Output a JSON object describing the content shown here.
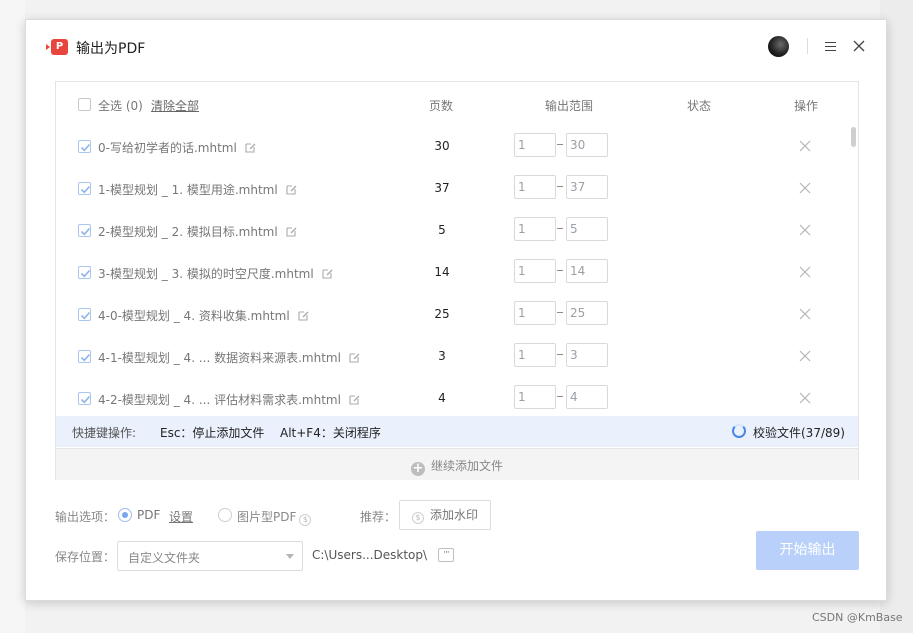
{
  "window": {
    "title": "输出为PDF",
    "logo_glyph": "P"
  },
  "table": {
    "header": {
      "select_all": "全选 (0)",
      "clear_all": "清除全部",
      "col_pages": "页数",
      "col_range": "输出范围",
      "col_status": "状态",
      "col_action": "操作"
    },
    "rows": [
      {
        "name": "0-写给初学者的话.mhtml",
        "pages": "30",
        "from": "1",
        "to": "30",
        "checked": true
      },
      {
        "name": "1-模型规划 _ 1. 模型用途.mhtml",
        "pages": "37",
        "from": "1",
        "to": "37",
        "checked": true
      },
      {
        "name": "2-模型规划 _ 2. 模拟目标.mhtml",
        "pages": "5",
        "from": "1",
        "to": "5",
        "checked": true
      },
      {
        "name": "3-模型规划 _ 3. 模拟的时空尺度.mhtml",
        "pages": "14",
        "from": "1",
        "to": "14",
        "checked": true
      },
      {
        "name": "4-0-模型规划 _ 4. 资料收集.mhtml",
        "pages": "25",
        "from": "1",
        "to": "25",
        "checked": true
      },
      {
        "name": "4-1-模型规划 _ 4. ... 数据资料来源表.mhtml",
        "pages": "3",
        "from": "1",
        "to": "3",
        "checked": true
      },
      {
        "name": "4-2-模型规划 _ 4. ... 评估材料需求表.mhtml",
        "pages": "4",
        "from": "1",
        "to": "4",
        "checked": true
      }
    ]
  },
  "shortcuts": {
    "label": "快捷键操作:",
    "esc": "Esc：停止添加文件",
    "altf4": "Alt+F4：关闭程序",
    "validate": "校验文件(37/89)"
  },
  "add_more": "继续添加文件",
  "options": {
    "label": "输出选项：",
    "pdf": "PDF",
    "settings": "设置",
    "image_pdf": "图片型PDF",
    "coin_glyph": "$",
    "recommend": "推荐：",
    "watermark": "添加水印",
    "selected": "PDF"
  },
  "save": {
    "label": "保存位置：",
    "select_value": "自定义文件夹",
    "path": "C:\\Users...Desktop\\",
    "browse": "···"
  },
  "start_button": "开始输出",
  "watermark_text": "CSDN @KmBase",
  "colors": {
    "accent": "#4a86e8",
    "start_disabled": "#b9d1fa",
    "shortcut_bg": "#eaf1fd",
    "logo": "#e8453c"
  }
}
